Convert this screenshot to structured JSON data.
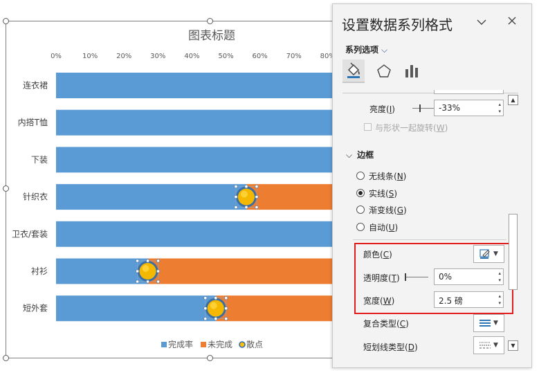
{
  "chart": {
    "title": "图表标题",
    "legend": [
      {
        "label": "完成率",
        "color": "#5b9bd5",
        "marker": "square"
      },
      {
        "label": "未完成",
        "color": "#ed7d31",
        "marker": "square"
      },
      {
        "label": "散点",
        "color": "#2e6db4",
        "marker": "circle"
      }
    ]
  },
  "chart_data": {
    "type": "bar",
    "orientation": "horizontal",
    "stacked": true,
    "title": "图表标题",
    "categories": [
      "连衣裙",
      "内搭T恤",
      "下装",
      "针织衣",
      "卫衣/套装",
      "衬衫",
      "短外套"
    ],
    "x_ticks": [
      "0%",
      "10%",
      "20%",
      "30%",
      "40%",
      "50%",
      "60%",
      "70%",
      "80%"
    ],
    "xlim": [
      0,
      1
    ],
    "series": [
      {
        "name": "完成率",
        "color": "#5b9bd5",
        "values": [
          1.0,
          1.0,
          1.0,
          0.56,
          1.0,
          0.27,
          0.47
        ]
      },
      {
        "name": "未完成",
        "color": "#ed7d31",
        "values": [
          0.0,
          0.0,
          0.0,
          0.44,
          0.0,
          0.73,
          0.53
        ]
      },
      {
        "name": "散点",
        "type": "scatter",
        "color": "#f2b705",
        "points": [
          {
            "category": "针织衣",
            "x": 0.56
          },
          {
            "category": "衬衫",
            "x": 0.27
          },
          {
            "category": "短外套",
            "x": 0.47
          }
        ]
      }
    ],
    "legend_position": "bottom"
  },
  "pane": {
    "title": "设置数据系列格式",
    "series_options_label": "系列选项",
    "tabs": [
      {
        "name": "fill-line",
        "icon": "paint-bucket-icon"
      },
      {
        "name": "effects",
        "icon": "pentagon-icon"
      },
      {
        "name": "series-options",
        "icon": "bar-chart-icon"
      }
    ],
    "brightness": {
      "label": "亮度(I)",
      "key": "I",
      "prefix": "亮度(",
      "suffix": ")",
      "value": "-33%"
    },
    "rotate_with_shape": {
      "label": "与形状一起旋转(W)",
      "prefix": "与形状一起旋转(",
      "key": "W",
      "suffix": ")",
      "checked": false,
      "disabled": true
    },
    "border_section": "边框",
    "border_options": [
      {
        "prefix": "无线条(",
        "key": "N",
        "suffix": ")",
        "selected": false
      },
      {
        "prefix": "实线(",
        "key": "S",
        "suffix": ")",
        "selected": true
      },
      {
        "prefix": "渐变线(",
        "key": "G",
        "suffix": ")",
        "selected": false
      },
      {
        "prefix": "自动(",
        "key": "U",
        "suffix": ")",
        "selected": false
      }
    ],
    "color": {
      "prefix": "颜色(",
      "key": "C",
      "suffix": ")"
    },
    "transparency": {
      "prefix": "透明度(",
      "key": "T",
      "suffix": ")",
      "value": "0%"
    },
    "width": {
      "prefix": "宽度(",
      "key": "W",
      "suffix": ")",
      "value": "2.5 磅"
    },
    "compound_type": {
      "prefix": "复合类型(",
      "key": "C",
      "suffix": ")"
    },
    "dash_type": {
      "prefix": "短划线类型(",
      "key": "D",
      "suffix": ")"
    },
    "highlight_color": "#e41b1b"
  }
}
